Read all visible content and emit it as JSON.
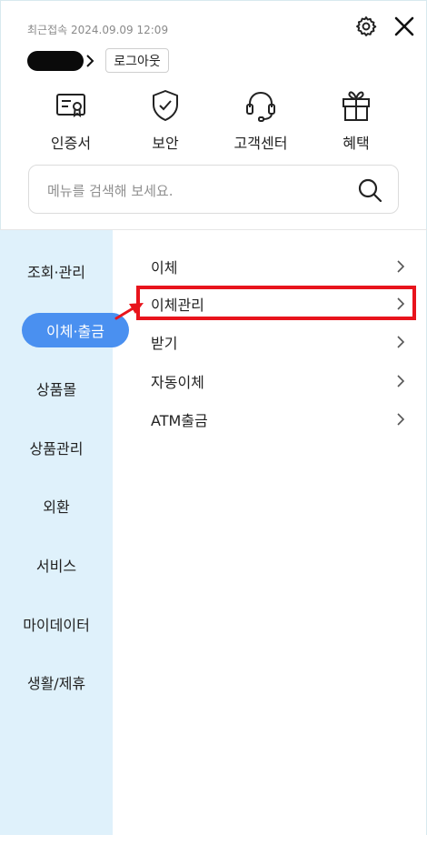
{
  "header": {
    "last_login": "최근접속 2024.09.09 12:09",
    "logout_label": "로그아웃"
  },
  "quick_menu": [
    {
      "label": "인증서",
      "icon": "certificate-icon"
    },
    {
      "label": "보안",
      "icon": "shield-check-icon"
    },
    {
      "label": "고객센터",
      "icon": "headset-icon"
    },
    {
      "label": "혜택",
      "icon": "gift-icon"
    }
  ],
  "search": {
    "placeholder": "메뉴를 검색해 보세요."
  },
  "left_nav": [
    {
      "label": "조회·관리"
    },
    {
      "label": "이체·출금",
      "active": true
    },
    {
      "label": "상품몰"
    },
    {
      "label": "상품관리"
    },
    {
      "label": "외환"
    },
    {
      "label": "서비스"
    },
    {
      "label": "마이데이터"
    },
    {
      "label": "생활/제휴"
    }
  ],
  "sub_menu": [
    {
      "label": "이체"
    },
    {
      "label": "이체관리",
      "highlighted": true
    },
    {
      "label": "받기"
    },
    {
      "label": "자동이체"
    },
    {
      "label": "ATM출금"
    }
  ],
  "colors": {
    "active_pill": "#4a90f0",
    "left_nav_bg": "#dff1fb",
    "highlight_border": "#e8141c"
  }
}
